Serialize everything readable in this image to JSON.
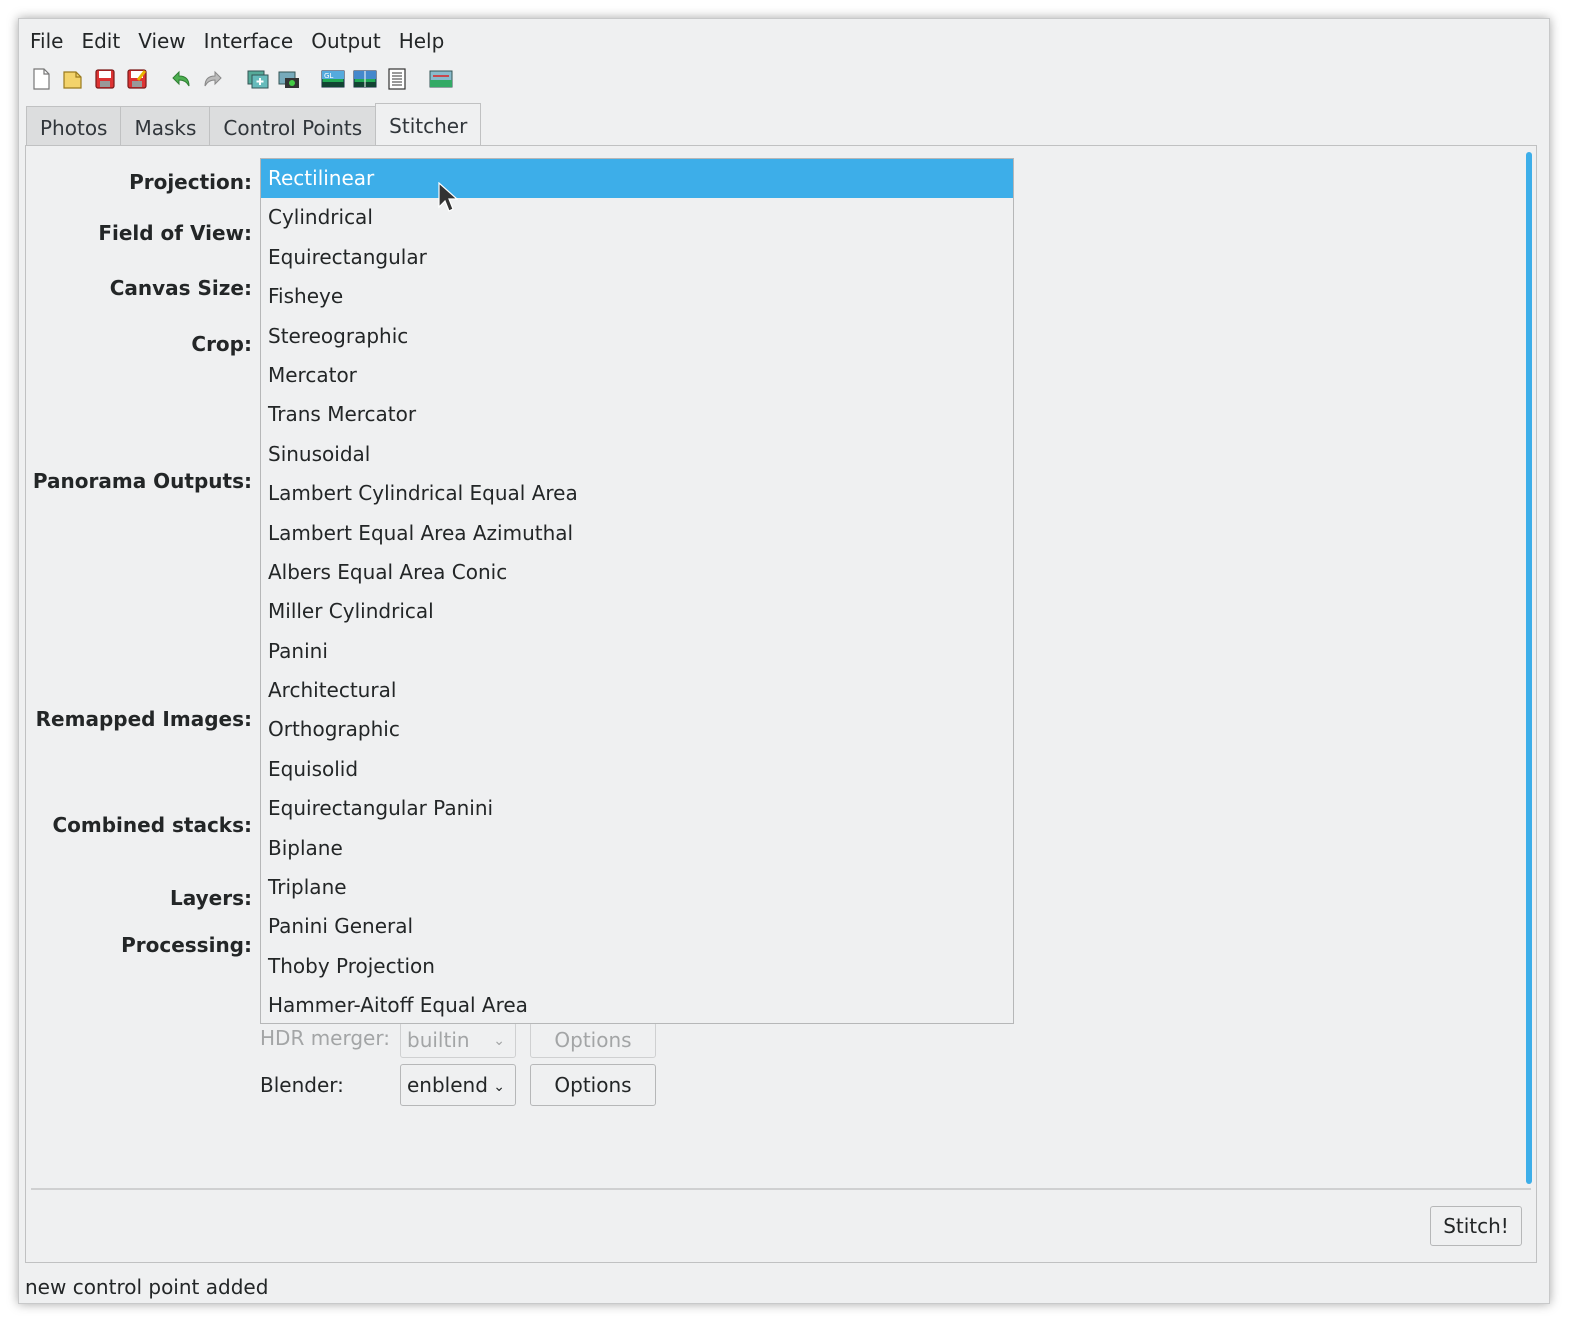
{
  "menu": [
    "File",
    "Edit",
    "View",
    "Interface",
    "Output",
    "Help"
  ],
  "toolbar": {
    "icons": [
      "new-file-icon",
      "open-file-icon",
      "save-icon",
      "save-as-icon",
      "undo-icon",
      "redo-icon",
      "add-images-icon",
      "add-time-series-icon",
      "fast-preview-gl-icon",
      "preview-icon",
      "layout-icon",
      "optimizer-icon"
    ]
  },
  "tabs": [
    "Photos",
    "Masks",
    "Control Points",
    "Stitcher"
  ],
  "labels": {
    "projection": "Projection:",
    "field_of_view": "Field of View:",
    "canvas_size": "Canvas Size:",
    "crop": "Crop:",
    "panorama_outputs": "Panorama Outputs:",
    "remapped_images": "Remapped Images:",
    "combined_stacks": "Combined stacks:",
    "layers": "Layers:",
    "processing": "Processing:"
  },
  "projection_options": [
    "Rectilinear",
    "Cylindrical",
    "Equirectangular",
    "Fisheye",
    "Stereographic",
    "Mercator",
    "Trans Mercator",
    "Sinusoidal",
    "Lambert Cylindrical Equal Area",
    "Lambert Equal Area Azimuthal",
    "Albers Equal Area Conic",
    "Miller Cylindrical",
    "Panini",
    "Architectural",
    "Orthographic",
    "Equisolid",
    "Equirectangular Panini",
    "Biplane",
    "Triplane",
    "Panini General",
    "Thoby Projection",
    "Hammer-Aitoff Equal Area"
  ],
  "selected_projection": "Rectilinear",
  "processing": {
    "hdr_merger_label": "HDR merger:",
    "hdr_merger_value": "builtin",
    "hdr_options": "Options",
    "blender_label": "Blender:",
    "blender_value": "enblend",
    "blender_options": "Options"
  },
  "stitch_button": "Stitch!",
  "status": "new control point added",
  "colors": {
    "accent": "#3daee9",
    "window_bg": "#eff0f1"
  }
}
